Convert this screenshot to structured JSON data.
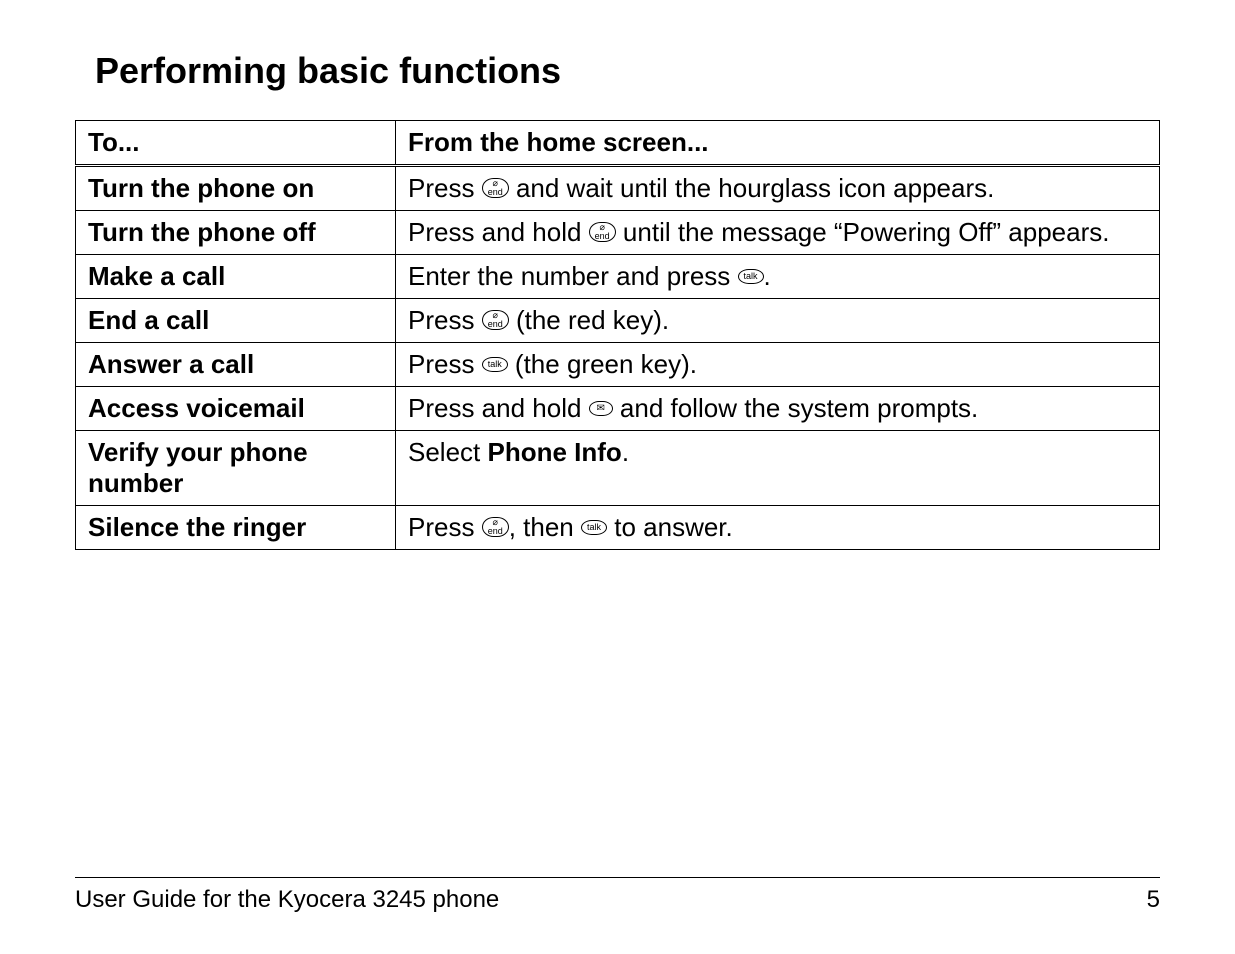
{
  "title": "Performing basic functions",
  "headers": {
    "col1": "To...",
    "col2": "From the home screen..."
  },
  "rows": [
    {
      "label": "Turn the phone on",
      "parts": [
        {
          "t": "text",
          "v": "Press "
        },
        {
          "t": "icon",
          "v": "end"
        },
        {
          "t": "text",
          "v": " and wait until the hourglass icon appears."
        }
      ]
    },
    {
      "label": "Turn the phone off",
      "parts": [
        {
          "t": "text",
          "v": "Press and hold "
        },
        {
          "t": "icon",
          "v": "end"
        },
        {
          "t": "text",
          "v": " until the message “Powering Off” appears."
        }
      ]
    },
    {
      "label": "Make a call",
      "parts": [
        {
          "t": "text",
          "v": "Enter the number and press "
        },
        {
          "t": "icon",
          "v": "talk"
        },
        {
          "t": "text",
          "v": "."
        }
      ]
    },
    {
      "label": "End a call",
      "parts": [
        {
          "t": "text",
          "v": "Press "
        },
        {
          "t": "icon",
          "v": "end"
        },
        {
          "t": "text",
          "v": " (the red key)."
        }
      ]
    },
    {
      "label": "Answer a call",
      "parts": [
        {
          "t": "text",
          "v": "Press "
        },
        {
          "t": "icon",
          "v": "talk"
        },
        {
          "t": "text",
          "v": " (the green key)."
        }
      ]
    },
    {
      "label": "Access voicemail",
      "parts": [
        {
          "t": "text",
          "v": "Press and hold "
        },
        {
          "t": "icon",
          "v": "vm"
        },
        {
          "t": "text",
          "v": " and follow the system prompts."
        }
      ]
    },
    {
      "label": "Verify your phone number",
      "parts": [
        {
          "t": "text",
          "v": "Select "
        },
        {
          "t": "bold",
          "v": "Phone Info"
        },
        {
          "t": "text",
          "v": "."
        }
      ]
    },
    {
      "label": "Silence the ringer",
      "parts": [
        {
          "t": "text",
          "v": "Press "
        },
        {
          "t": "icon",
          "v": "end"
        },
        {
          "t": "text",
          "v": ", then "
        },
        {
          "t": "icon",
          "v": "talk"
        },
        {
          "t": "text",
          "v": " to answer."
        }
      ]
    }
  ],
  "footer": {
    "left": "User Guide for the Kyocera 3245 phone",
    "right": "5"
  }
}
